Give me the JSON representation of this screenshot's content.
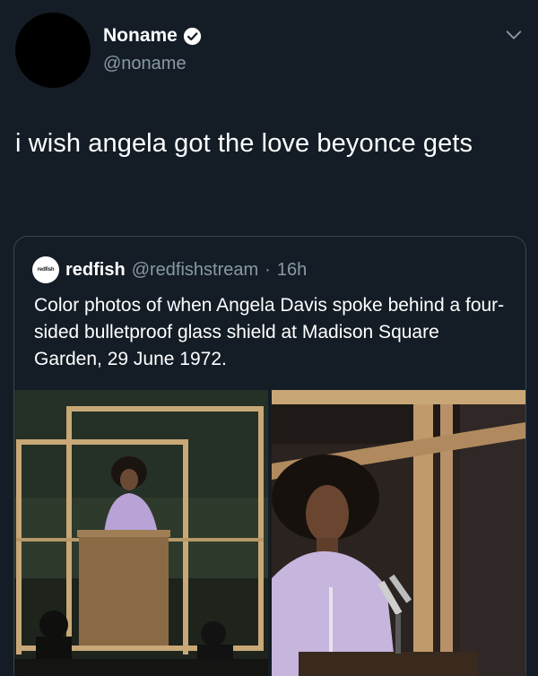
{
  "author": {
    "display_name": "Noname",
    "handle": "@noname",
    "verified_icon": "verified-badge-icon"
  },
  "tweet": {
    "text": "i wish angela got the love beyonce gets"
  },
  "quoted_tweet": {
    "avatar_text": "redfish",
    "display_name": "redfish",
    "handle": "@redfishstream",
    "separator": "·",
    "time": "16h",
    "text": "Color photos of when Angela Davis spoke behind a four-sided bulletproof glass shield at Madison Square Garden, 29 June 1972."
  },
  "colors": {
    "background": "#141d26",
    "secondary_text": "#8899a6",
    "border": "#38444d",
    "verified_badge": "#ffffff"
  }
}
